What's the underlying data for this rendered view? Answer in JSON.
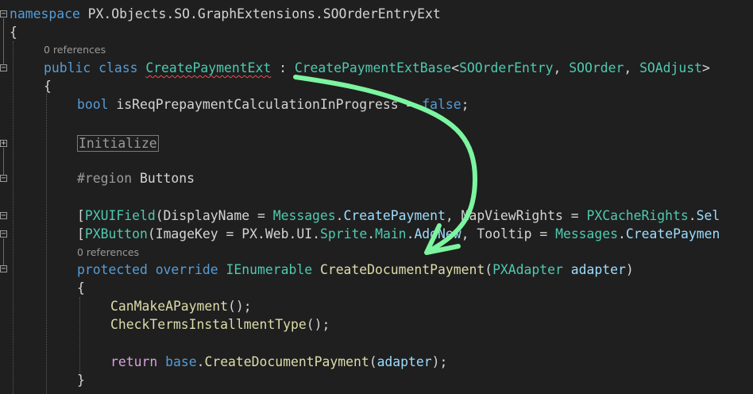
{
  "code": {
    "namespace_kw": "namespace",
    "namespace_name": " PX.Objects.SO.GraphExtensions.SOOrderEntryExt",
    "brace_open": "{",
    "brace_close": "}",
    "ref_class": "0 references",
    "class_decl": {
      "kw_public": "public",
      "kw_class": "class",
      "name": "CreatePaymentExt",
      "colon": " : ",
      "base": "CreatePaymentExtBase",
      "lt": "<",
      "arg1": "SOOrderEntry",
      "comma1": ", ",
      "arg2": "SOOrder",
      "comma2": ", ",
      "arg3": "SOAdjust",
      "gt": ">"
    },
    "field": {
      "type": "bool",
      "name": " isReqPrepaymentCalculationInProgress = ",
      "value": "false",
      "semi": ";"
    },
    "collapsed_region": "Initialize",
    "region": {
      "kw": "#region",
      "name": " Buttons"
    },
    "attr1": {
      "open": "[",
      "type": "PXUIField",
      "p1": "(DisplayName = ",
      "t1": "Messages",
      "d1": ".",
      "m1": "CreatePayment",
      "p2": ", MapViewRights = ",
      "t2": "PXCacheRights",
      "d2": ".",
      "m2": "Sel"
    },
    "attr2": {
      "open": "[",
      "type": "PXButton",
      "p1": "(ImageKey = ",
      "ns1": "PX",
      "d1": ".",
      "ns2": "Web",
      "d2": ".",
      "ns3": "UI",
      "d3": ".",
      "t1": "Sprite",
      "d4": ".",
      "t2": "Main",
      "d5": ".",
      "m1": "AddNew",
      "p2": ", Tooltip = ",
      "t3": "Messages",
      "d6": ".",
      "m2": "CreatePaymen"
    },
    "ref_method": "0 references",
    "method": {
      "kw1": "protected",
      "kw2": "override",
      "ret": "IEnumerable",
      "name": "CreateDocumentPayment",
      "paren_open": "(",
      "ptype": "PXAdapter",
      "pname": "adapter",
      "paren_close": ")"
    },
    "body": {
      "call1": "CanMakeAPayment",
      "call1_rest": "();",
      "call2": "CheckTermsInstallmentType",
      "call2_rest": "();",
      "ret_kw": "return",
      "base_kw": "base",
      "dot": ".",
      "ret_call": "CreateDocumentPayment",
      "ret_open": "(",
      "ret_arg": "adapter",
      "ret_close": ");"
    }
  },
  "colors": {
    "background": "#1f1f1f",
    "keyword": "#569cd6",
    "control": "#d8a0df",
    "type": "#4ec9b0",
    "method": "#dcdcaa",
    "variable": "#9cdcfe",
    "annotation_arrow": "#7cf5a0"
  },
  "annotation": {
    "shape": "hand-drawn-arrow",
    "color": "#7cf5a0"
  }
}
